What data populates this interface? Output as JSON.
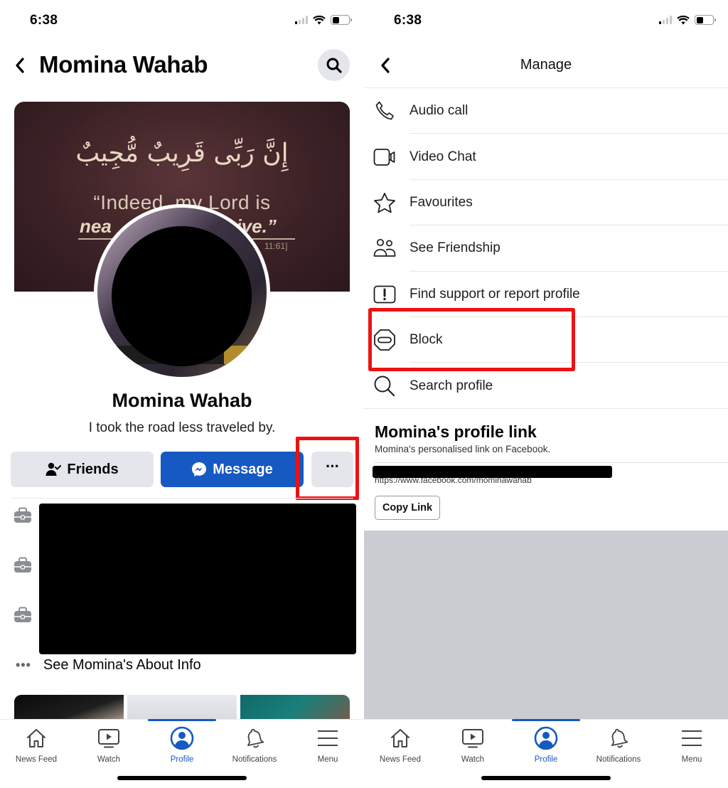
{
  "status_bar": {
    "time": "6:38"
  },
  "profile_screen": {
    "header_title": "Momina Wahab",
    "cover": {
      "arabic_text": "إِنَّ رَبِّى قَرِيبٌ مُّجِيبٌ",
      "quote_line1": "“Indeed, my Lord is",
      "quote_line2a": "nea",
      "quote_line2b": "sive.”",
      "reference": "11:61]"
    },
    "name": "Momina Wahab",
    "bio": "I took the road less traveled by.",
    "buttons": {
      "friends": "Friends",
      "message": "Message",
      "more": "···"
    },
    "about": {
      "items": [
        "work",
        "work",
        "work"
      ],
      "see_more": "See Momina's About Info"
    }
  },
  "manage_screen": {
    "title": "Manage",
    "menu": [
      {
        "icon": "phone-icon",
        "label": "Audio call"
      },
      {
        "icon": "video-camera-icon",
        "label": "Video Chat"
      },
      {
        "icon": "star-icon",
        "label": "Favourites"
      },
      {
        "icon": "friends-icon",
        "label": "See Friendship"
      },
      {
        "icon": "report-icon",
        "label": "Find support or report profile"
      },
      {
        "icon": "block-icon",
        "label": "Block"
      },
      {
        "icon": "search-icon",
        "label": "Search profile"
      }
    ],
    "profile_link": {
      "title": "Momina's profile link",
      "subtitle": "Momina's personalised link on Facebook.",
      "url": "https://www.facebook.com/mominawahab",
      "copy_button": "Copy Link"
    }
  },
  "tab_bar": {
    "tabs": [
      {
        "icon": "home-icon",
        "label": "News Feed"
      },
      {
        "icon": "watch-icon",
        "label": "Watch"
      },
      {
        "icon": "profile-icon",
        "label": "Profile",
        "active": true
      },
      {
        "icon": "bell-icon",
        "label": "Notifications"
      },
      {
        "icon": "menu-icon",
        "label": "Menu"
      }
    ]
  },
  "colors": {
    "accent": "#1659c2",
    "highlight": "#ee1111",
    "button_gray": "#e4e6eb"
  }
}
